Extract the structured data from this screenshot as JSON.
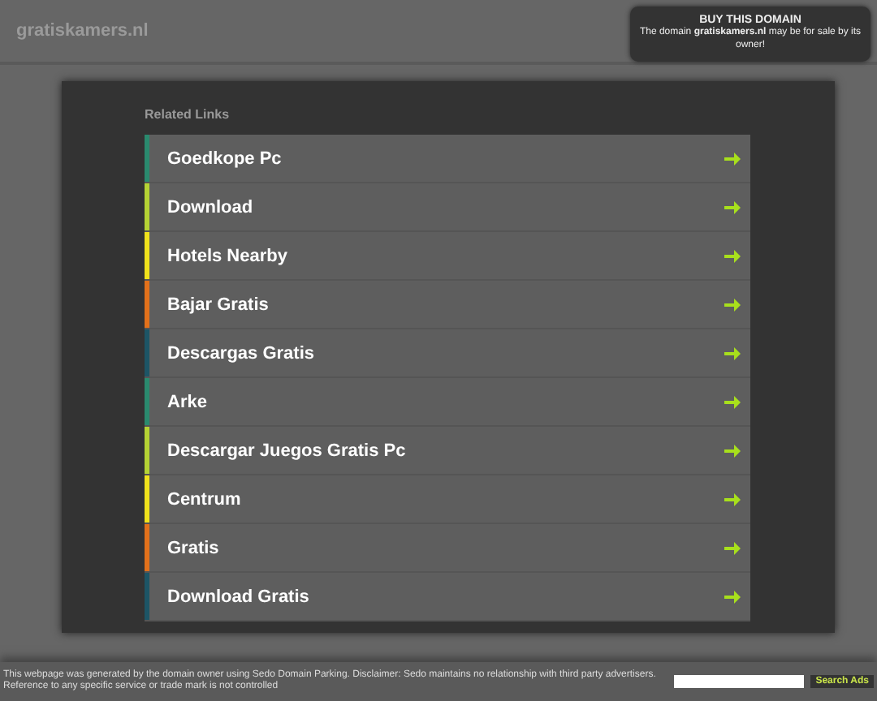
{
  "header": {
    "site": "gratiskamers.nl"
  },
  "sale_box": {
    "title": "BUY THIS DOMAIN",
    "text": "The domain **gratiskamers.nl** may be for sale by its owner!"
  },
  "related": {
    "title": "Related Links",
    "links": [
      {
        "label": "Goedkope Pc",
        "color": "#2a8a6e"
      },
      {
        "label": "Download",
        "color": "#b5d334"
      },
      {
        "label": "Hotels Nearby",
        "color": "#f0e21c"
      },
      {
        "label": "Bajar Gratis",
        "color": "#e2711b"
      },
      {
        "label": "Descargas Gratis",
        "color": "#1d5566"
      },
      {
        "label": "Arke",
        "color": "#2a8a6e"
      },
      {
        "label": "Descargar Juegos Gratis Pc",
        "color": "#b5d334"
      },
      {
        "label": "Centrum",
        "color": "#f0e21c"
      },
      {
        "label": "Gratis",
        "color": "#e2711b"
      },
      {
        "label": "Download Gratis",
        "color": "#1d5566"
      }
    ]
  },
  "footer": {
    "text": "This webpage was generated by the domain owner using Sedo Domain Parking. Disclaimer: Sedo maintains no relationship with third party advertisers. Reference to any specific service or trade mark is not controlled",
    "button": "Search Ads"
  }
}
